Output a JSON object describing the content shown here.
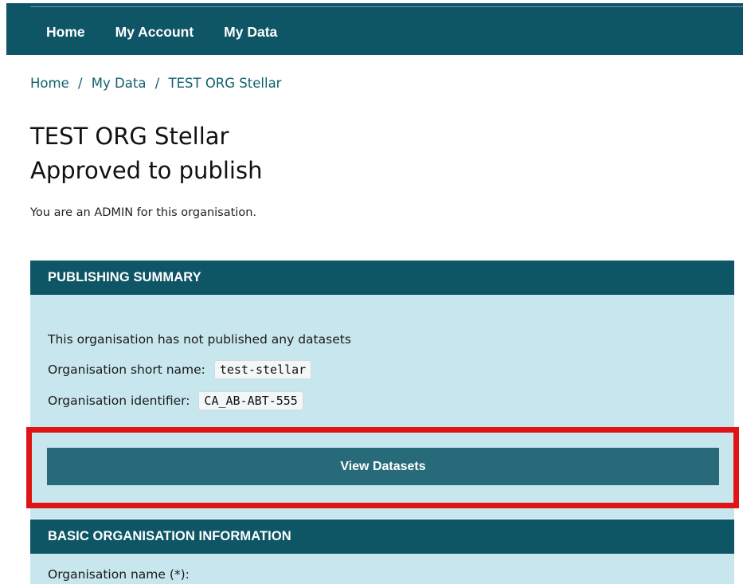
{
  "nav": {
    "items": [
      {
        "label": "Home"
      },
      {
        "label": "My Account"
      },
      {
        "label": "My Data"
      }
    ]
  },
  "breadcrumb": {
    "items": [
      "Home",
      "My Data",
      "TEST ORG Stellar"
    ],
    "separator": "/"
  },
  "page": {
    "title_line1": "TEST ORG Stellar",
    "title_line2": "Approved to publish",
    "role_text": "You are an ADMIN for this organisation."
  },
  "publishing_summary": {
    "header": "PUBLISHING SUMMARY",
    "status_text": "This organisation has not published any datasets",
    "short_name_label": "Organisation short name:",
    "short_name_value": "test-stellar",
    "identifier_label": "Organisation identifier:",
    "identifier_value": "CA_AB-ABT-555",
    "view_datasets_label": "View Datasets"
  },
  "basic_info": {
    "header": "BASIC ORGANISATION INFORMATION",
    "org_name_label": "Organisation name (*):"
  },
  "colors": {
    "nav_bg": "#0e5566",
    "panel_bg": "#c8e6ee",
    "button_bg": "#276b7a",
    "highlight": "#e01414"
  }
}
